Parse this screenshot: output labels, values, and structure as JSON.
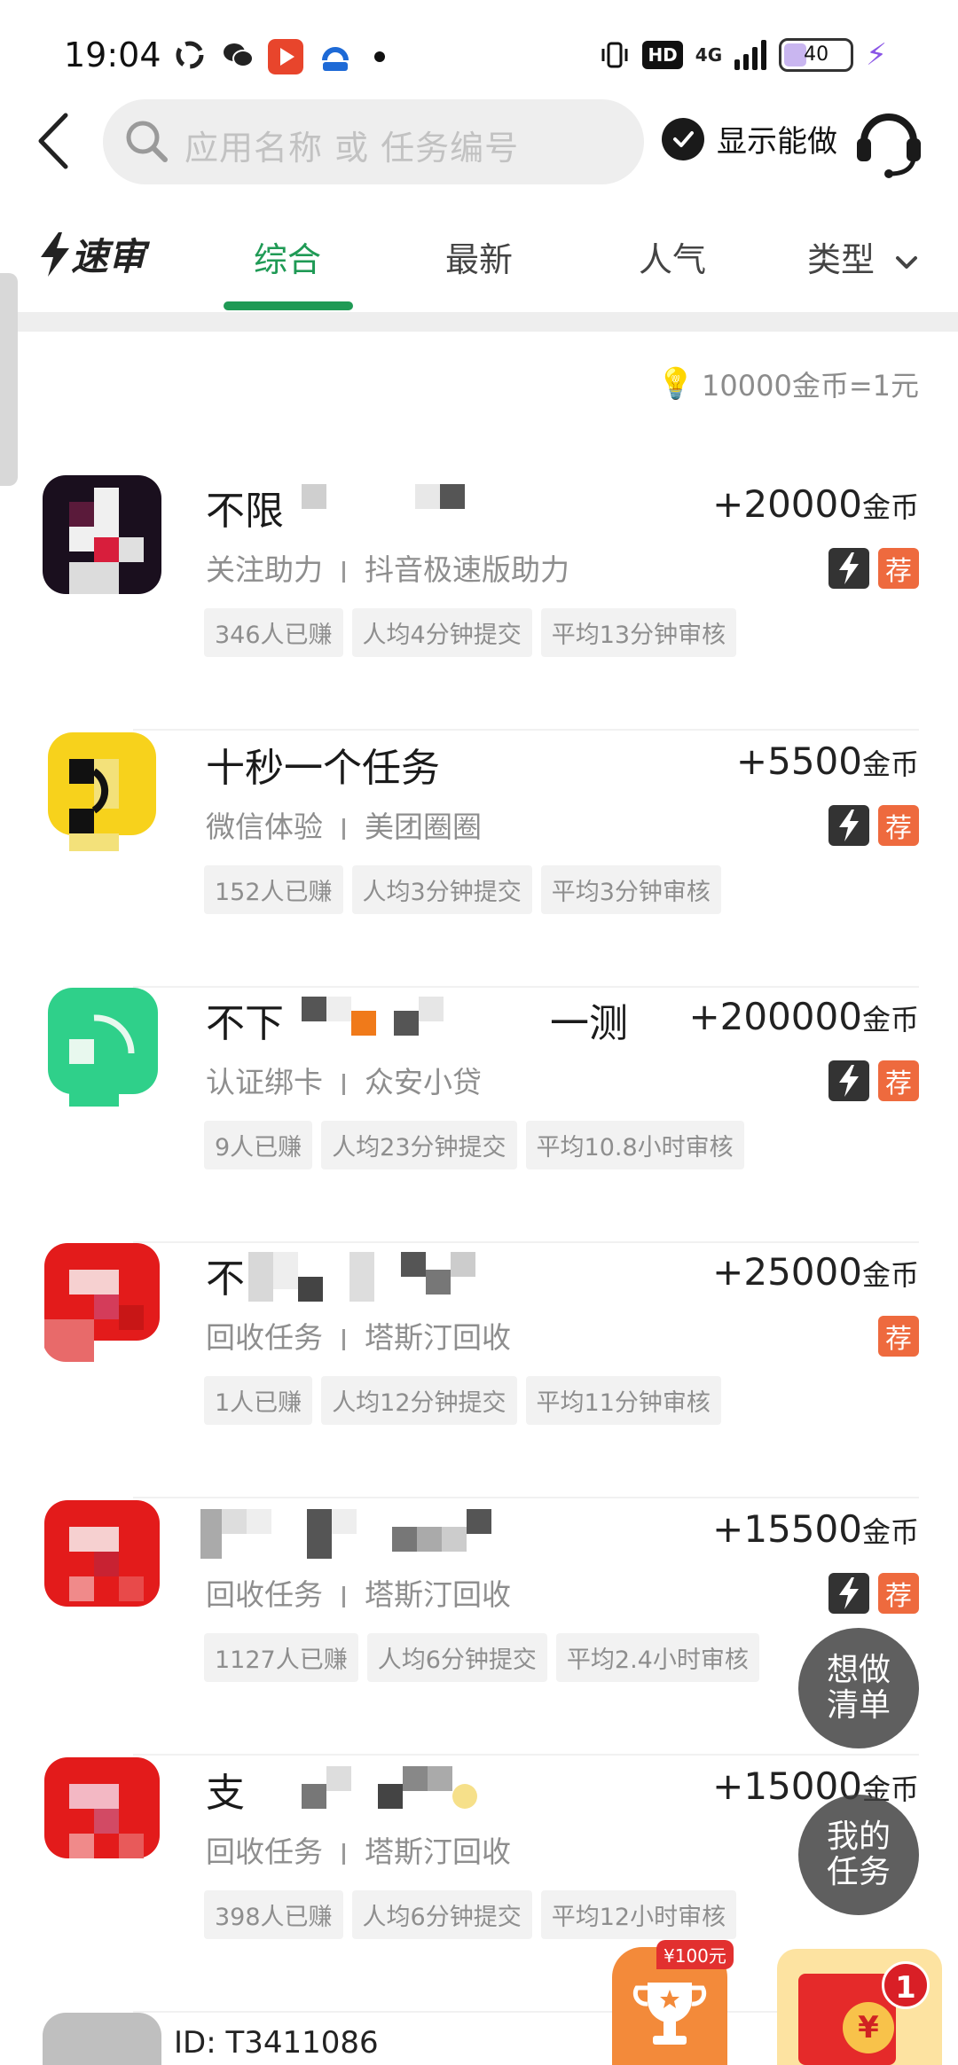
{
  "status_bar": {
    "time": "19:04",
    "network": "4G",
    "hd": "HD",
    "battery": "40",
    "battery_level": 0.4
  },
  "header": {
    "search_placeholder": "应用名称 或 任务编号",
    "show_can_do": "显示能做"
  },
  "tabs": {
    "quick_review": "速审",
    "items": [
      "综合",
      "最新",
      "人气",
      "类型"
    ],
    "active": "综合"
  },
  "exchange_rate": "10000金币=1元",
  "tasks": [
    {
      "title": "不限",
      "reward": "+20000",
      "unit": "金币",
      "category": "关注助力",
      "app": "抖音极速版助力",
      "fast": true,
      "recommended": "荐",
      "tags": [
        "346人已赚",
        "人均4分钟提交",
        "平均13分钟审核"
      ]
    },
    {
      "title": "十秒一个任务",
      "reward": "+5500",
      "unit": "金币",
      "category": "微信体验",
      "app": "美团圈圈",
      "fast": true,
      "recommended": "荐",
      "tags": [
        "152人已赚",
        "人均3分钟提交",
        "平均3分钟审核"
      ]
    },
    {
      "title_prefix": "不下",
      "title_suffix": "一测",
      "reward": "+200000",
      "unit": "金币",
      "category": "认证绑卡",
      "app": "众安小贷",
      "fast": true,
      "recommended": "荐",
      "tags": [
        "9人已赚",
        "人均23分钟提交",
        "平均10.8小时审核"
      ]
    },
    {
      "title": "不",
      "reward": "+25000",
      "unit": "金币",
      "category": "回收任务",
      "app": "塔斯汀回收",
      "fast": false,
      "recommended": "荐",
      "tags": [
        "1人已赚",
        "人均12分钟提交",
        "平均11分钟审核"
      ]
    },
    {
      "title": "",
      "reward": "+15500",
      "unit": "金币",
      "category": "回收任务",
      "app": "塔斯汀回收",
      "fast": true,
      "recommended": "荐",
      "tags": [
        "1127人已赚",
        "人均6分钟提交",
        "平均2.4小时审核"
      ]
    },
    {
      "title": "支",
      "reward": "+15000",
      "unit": "金币",
      "category": "回收任务",
      "app": "塔斯汀回收",
      "fast": false,
      "recommended": "",
      "tags": [
        "398人已赚",
        "人均6分钟提交",
        "平均12小时审核"
      ]
    }
  ],
  "floating": {
    "wishlist": [
      "想做",
      "清单"
    ],
    "my_tasks": [
      "我的",
      "任务"
    ],
    "promo_tag": "¥100元",
    "redpacket_count": "1",
    "redpacket_symbol": "¥"
  },
  "bottom": {
    "uid": "ID: T3411086"
  },
  "colors": {
    "accent": "#1f9a55",
    "recommend": "#ee6a3e"
  }
}
